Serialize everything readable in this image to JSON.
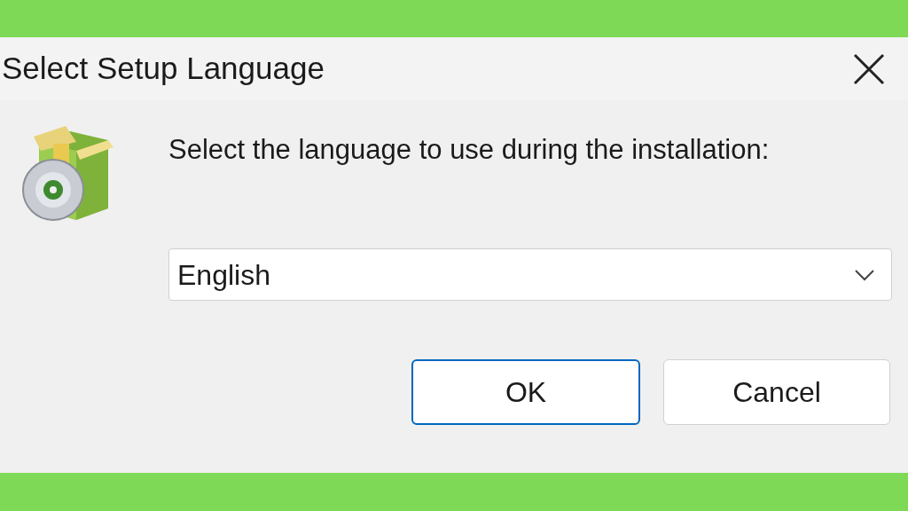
{
  "window": {
    "title": "Select Setup Language"
  },
  "message": "Select the language to use during the installation:",
  "language_select": {
    "value": "English"
  },
  "buttons": [
    {
      "label": "OK",
      "default": true
    },
    {
      "label": "Cancel",
      "default": false
    }
  ]
}
